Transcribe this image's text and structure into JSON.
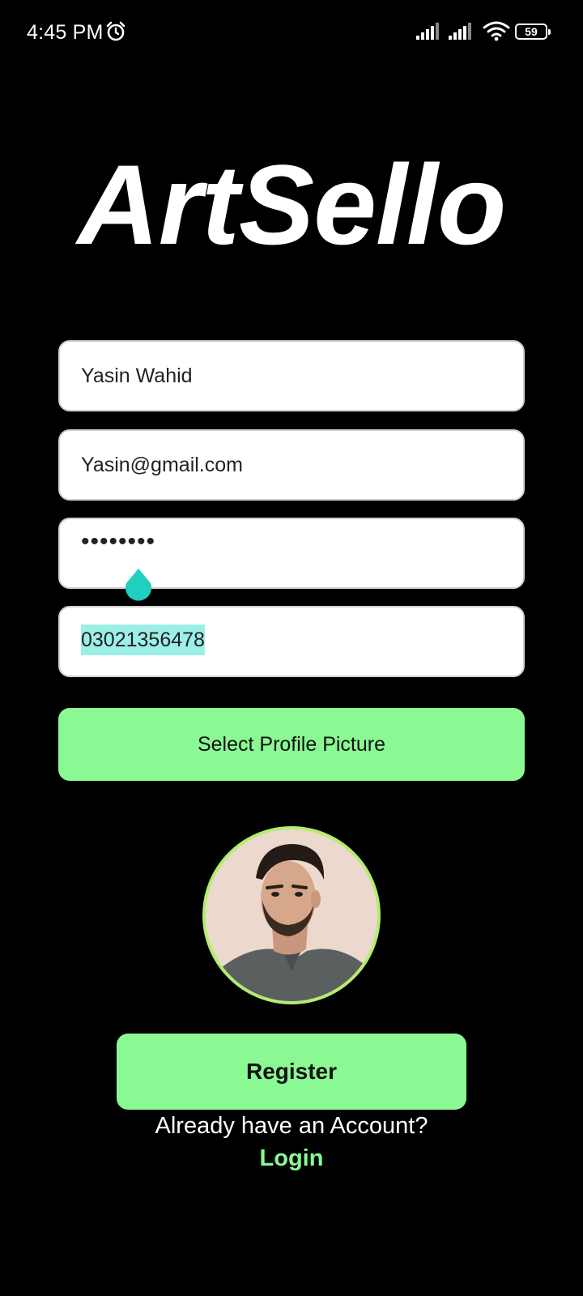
{
  "status_bar": {
    "time": "4:45 PM",
    "battery": "59",
    "icons": [
      "alarm-icon",
      "signal-icon",
      "signal-icon",
      "wifi-icon",
      "battery-icon"
    ]
  },
  "app": {
    "logo_text": "ArtSello"
  },
  "form": {
    "name_value": "Yasin Wahid",
    "email_value": "Yasin@gmail.com",
    "password_value": "••••••••",
    "phone_value": "03021356478",
    "select_picture_label": "Select Profile Picture",
    "register_label": "Register",
    "already_account_text": "Already have an Account?",
    "login_label": "Login"
  },
  "colors": {
    "background": "#000000",
    "accent_green": "#8af893",
    "avatar_ring": "#b4ec70",
    "text_selection": "#9cefe6",
    "selection_handle": "#1fcfc0"
  }
}
